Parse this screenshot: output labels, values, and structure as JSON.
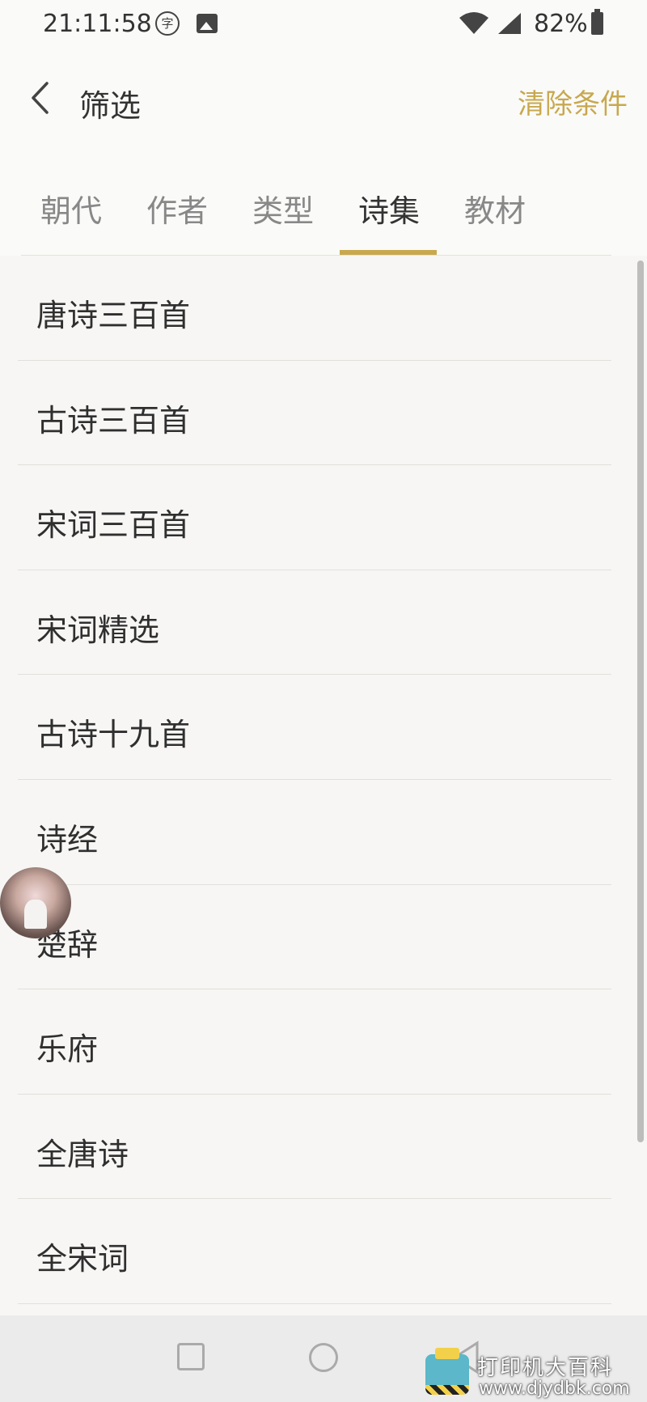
{
  "status_bar": {
    "time": "21:11:58",
    "battery": "82%",
    "zi_icon_glyph": "字"
  },
  "header": {
    "title": "筛选",
    "clear_label": "清除条件"
  },
  "tabs": [
    {
      "label": "朝代",
      "active": false
    },
    {
      "label": "作者",
      "active": false
    },
    {
      "label": "类型",
      "active": false
    },
    {
      "label": "诗集",
      "active": true
    },
    {
      "label": "教材",
      "active": false
    }
  ],
  "list": {
    "items": [
      {
        "label": "唐诗三百首"
      },
      {
        "label": "古诗三百首"
      },
      {
        "label": "宋词三百首"
      },
      {
        "label": "宋词精选"
      },
      {
        "label": "古诗十九首"
      },
      {
        "label": "诗经"
      },
      {
        "label": "楚辞"
      },
      {
        "label": "乐府"
      },
      {
        "label": "全唐诗"
      },
      {
        "label": "全宋词"
      }
    ]
  },
  "watermark": {
    "title": "打印机大百科",
    "url": "www.djydbk.com"
  },
  "colors": {
    "accent": "#c8a84f",
    "background": "#f7f6f4",
    "text": "#333333"
  }
}
